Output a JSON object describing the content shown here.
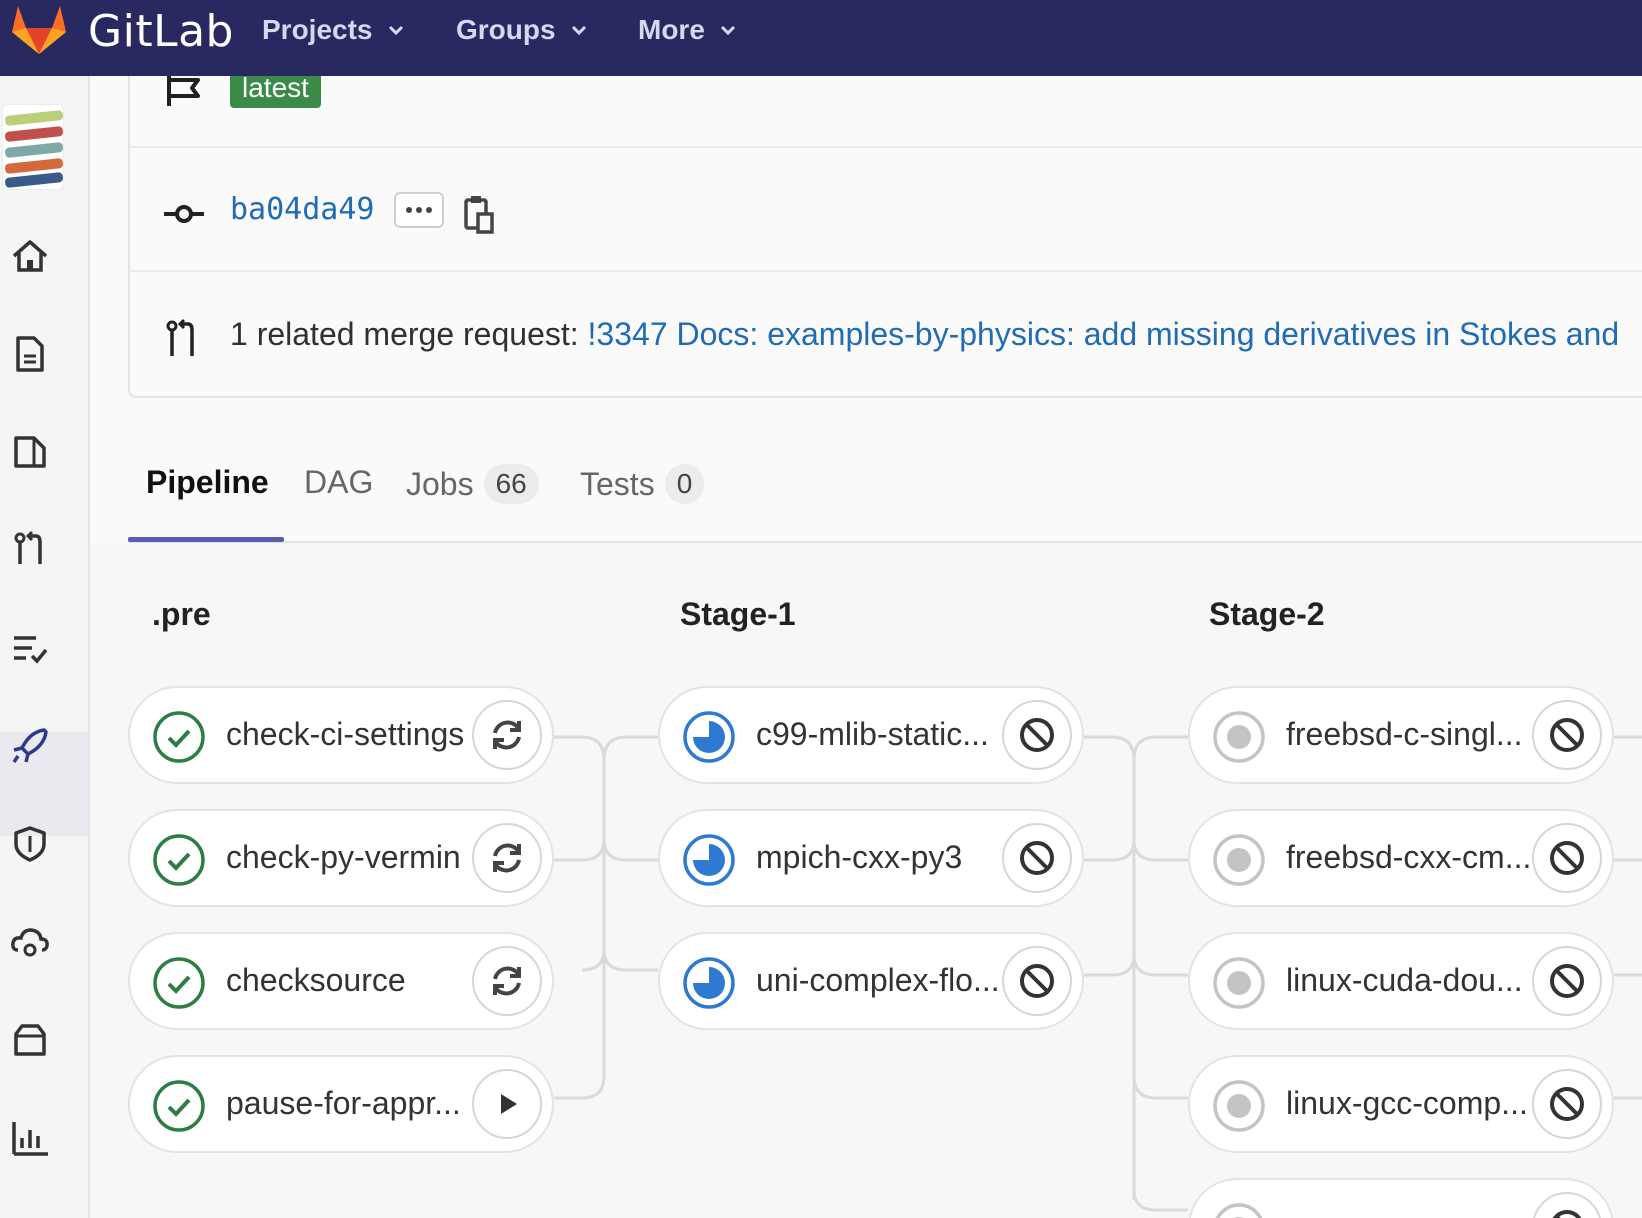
{
  "navbar": {
    "brand": "GitLab",
    "items": [
      {
        "label": "Projects",
        "icon": "chevron-down-icon"
      },
      {
        "label": "Groups",
        "icon": "chevron-down-icon"
      },
      {
        "label": "More",
        "icon": "chevron-down-icon"
      }
    ]
  },
  "sidebar": {
    "icons": [
      "home-icon",
      "file-icon",
      "issues-icon",
      "merge-request-icon",
      "requirements-icon",
      "rocket-icon",
      "shield-icon",
      "cloud-gear-icon",
      "package-icon",
      "chart-icon"
    ],
    "active": "rocket-icon"
  },
  "pipeline_info": {
    "tag": "latest",
    "commit_sha": "ba04da49",
    "mr_prefix": "1 related merge request: ",
    "mr_link": "!3347 Docs: examples-by-physics: add missing derivatives in Stokes and"
  },
  "tabs": [
    {
      "label": "Pipeline",
      "active": true
    },
    {
      "label": "DAG"
    },
    {
      "label": "Jobs",
      "count": "66"
    },
    {
      "label": "Tests",
      "count": "0"
    }
  ],
  "stages": [
    {
      "title": ".pre",
      "jobs": [
        {
          "name": "check-ci-settings",
          "status": "success",
          "action": "retry-icon"
        },
        {
          "name": "check-py-vermin",
          "status": "success",
          "action": "retry-icon"
        },
        {
          "name": "checksource",
          "status": "success",
          "action": "retry-icon"
        },
        {
          "name": "pause-for-appr...",
          "status": "success",
          "action": "play-icon"
        }
      ]
    },
    {
      "title": "Stage-1",
      "jobs": [
        {
          "name": "c99-mlib-static...",
          "status": "running",
          "action": "cancel-icon"
        },
        {
          "name": "mpich-cxx-py3",
          "status": "running",
          "action": "cancel-icon"
        },
        {
          "name": "uni-complex-flo...",
          "status": "running",
          "action": "cancel-icon"
        }
      ]
    },
    {
      "title": "Stage-2",
      "jobs": [
        {
          "name": "freebsd-c-singl...",
          "status": "pending",
          "action": "cancel-icon"
        },
        {
          "name": "freebsd-cxx-cm...",
          "status": "pending",
          "action": "cancel-icon"
        },
        {
          "name": "linux-cuda-dou...",
          "status": "pending",
          "action": "cancel-icon"
        },
        {
          "name": "linux-gcc-comp...",
          "status": "pending",
          "action": "cancel-icon"
        },
        {
          "name": "",
          "status": "pending",
          "action": "cancel-icon"
        }
      ]
    }
  ],
  "colors": {
    "navbar": "#292961",
    "success": "#2e7d45",
    "running": "#2f7ad1",
    "pending": "#c4c4c4",
    "link": "#1f6bb5",
    "tag": "#3a8a48"
  }
}
